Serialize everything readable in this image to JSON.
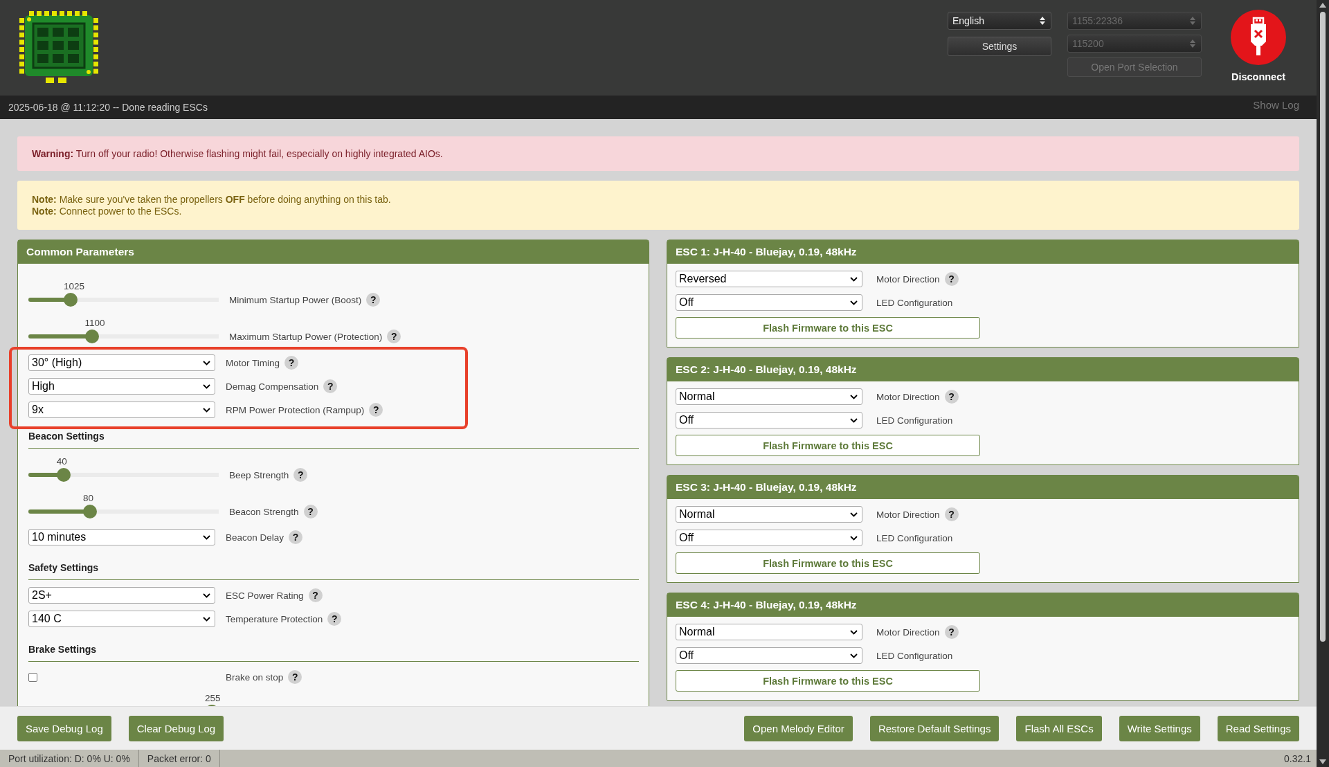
{
  "header": {
    "language": {
      "value": "English"
    },
    "settings_button": "Settings",
    "port": {
      "value": "1155:22336",
      "disabled": true
    },
    "baud": {
      "value": "115200",
      "disabled": true
    },
    "open_port_button": {
      "label": "Open Port Selection",
      "disabled": true
    },
    "connect_button": "Disconnect"
  },
  "log": {
    "message": "2025-06-18 @ 11:12:20 -- Done reading ESCs",
    "toggle": "Show Log"
  },
  "alerts": [
    {
      "kind": "warning",
      "lines": [
        "**Warning:** Turn off your radio! Otherwise flashing might fail, especially on highly integrated AIOs."
      ]
    },
    {
      "kind": "note",
      "lines": [
        "**Note:** Make sure you've taken the propellers **OFF** before doing anything on this tab.",
        "**Note:** Connect power to the ESCs."
      ]
    }
  ],
  "common": {
    "title": "Common Parameters",
    "items": [
      {
        "kind": "slider",
        "reading": "1025",
        "level": 0.2,
        "label": "Minimum Startup Power (Boost)",
        "help": "?",
        "highlighted": false
      },
      {
        "kind": "slider",
        "reading": "1100",
        "level": 0.32,
        "label": "Maximum Startup Power (Protection)",
        "help": "?",
        "highlighted": false
      },
      {
        "kind": "select",
        "value": "30° (High)",
        "label": "Motor Timing",
        "help": "?",
        "highlighted": true
      },
      {
        "kind": "select",
        "value": "High",
        "label": "Demag Compensation",
        "help": "?",
        "highlighted": true
      },
      {
        "kind": "select",
        "value": "9x",
        "label": "RPM Power Protection (Rampup)",
        "help": "?",
        "highlighted": true
      },
      {
        "kind": "heading",
        "title": "Beacon Settings"
      },
      {
        "kind": "slider",
        "reading": "40",
        "level": 0.16,
        "label": "Beep Strength",
        "help": "?",
        "highlighted": false
      },
      {
        "kind": "slider",
        "reading": "80",
        "level": 0.31,
        "label": "Beacon Strength",
        "help": "?",
        "highlighted": false
      },
      {
        "kind": "select",
        "value": "10 minutes",
        "label": "Beacon Delay",
        "help": "?",
        "highlighted": false
      },
      {
        "kind": "heading",
        "title": "Safety Settings"
      },
      {
        "kind": "select",
        "value": "2S+",
        "label": "ESC Power Rating",
        "help": "?",
        "highlighted": false
      },
      {
        "kind": "select",
        "value": "140 C",
        "label": "Temperature Protection",
        "help": "?",
        "highlighted": false
      },
      {
        "kind": "heading",
        "title": "Brake Settings"
      },
      {
        "kind": "checkbox",
        "checked": false,
        "label": "Brake on stop",
        "help": "?",
        "highlighted": false
      },
      {
        "kind": "slider",
        "reading": "255",
        "level": 1.0,
        "highlighted": false
      }
    ]
  },
  "escs": [
    {
      "title": "ESC 1: J-H-40 - Bluejay, 0.19, 48kHz",
      "fields": [
        {
          "value": "Reversed",
          "label": "Motor Direction",
          "help": "?"
        },
        {
          "value": "Off",
          "label": "LED Configuration"
        }
      ],
      "flash_button": "Flash Firmware to this ESC"
    },
    {
      "title": "ESC 2: J-H-40 - Bluejay, 0.19, 48kHz",
      "fields": [
        {
          "value": "Normal",
          "label": "Motor Direction",
          "help": "?"
        },
        {
          "value": "Off",
          "label": "LED Configuration"
        }
      ],
      "flash_button": "Flash Firmware to this ESC"
    },
    {
      "title": "ESC 3: J-H-40 - Bluejay, 0.19, 48kHz",
      "fields": [
        {
          "value": "Normal",
          "label": "Motor Direction",
          "help": "?"
        },
        {
          "value": "Off",
          "label": "LED Configuration"
        }
      ],
      "flash_button": "Flash Firmware to this ESC"
    },
    {
      "title": "ESC 4: J-H-40 - Bluejay, 0.19, 48kHz",
      "fields": [
        {
          "value": "Normal",
          "label": "Motor Direction",
          "help": "?"
        },
        {
          "value": "Off",
          "label": "LED Configuration"
        }
      ],
      "flash_button": "Flash Firmware to this ESC"
    }
  ],
  "footer": {
    "left_buttons": [
      "Save Debug Log",
      "Clear Debug Log"
    ],
    "right_buttons": [
      "Open Melody Editor",
      "Restore Default Settings",
      "Flash All ESCs",
      "Write Settings",
      "Read Settings"
    ]
  },
  "status_bar": {
    "port_utilization": "Port utilization: D: 0% U: 0%",
    "packet_error": "Packet error: 0",
    "version": "0.32.1"
  }
}
